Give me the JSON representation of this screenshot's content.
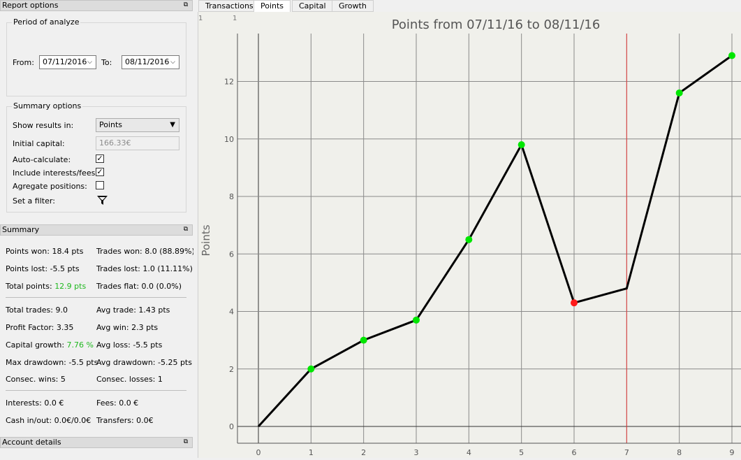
{
  "report_options": {
    "title": "Report options",
    "period_group": "Period of analyze",
    "from_label": "From:",
    "from_value": "07/11/2016",
    "to_label": "To:",
    "to_value": "08/11/2016",
    "summary_group": "Summary options",
    "show_results_label": "Show results in:",
    "show_results_value": "Points",
    "initial_capital_label": "Initial capital:",
    "initial_capital_value": "166.33€",
    "auto_calc_label": "Auto-calculate:",
    "auto_calc_checked": "✓",
    "include_fees_label": "Include interests/fees:",
    "include_fees_checked": "✓",
    "aggregate_label": "Agregate positions:",
    "filter_label": "Set a filter:"
  },
  "summary": {
    "title": "Summary",
    "points_won": "Points won: 18.4 pts",
    "trades_won": "Trades won: 8.0 (88.89%)",
    "points_lost": "Points lost: -5.5 pts",
    "trades_lost": "Trades lost: 1.0 (11.11%)",
    "total_points_label": "Total points:",
    "total_points_value": "12.9 pts",
    "trades_flat": "Trades flat: 0.0 (0.0%)",
    "total_trades": "Total trades: 9.0",
    "avg_trade": "Avg trade: 1.43 pts",
    "profit_factor": "Profit Factor: 3.35",
    "avg_win": "Avg win: 2.3 pts",
    "capital_growth_label": "Capital growth:",
    "capital_growth_value": "7.76 %",
    "avg_loss": "Avg loss: -5.5 pts",
    "max_drawdown": "Max drawdown: -5.5 pts",
    "avg_drawdown": "Avg drawdown: -5.25 pts",
    "consec_wins": "Consec. wins: 5",
    "consec_losses": "Consec. losses: 1",
    "interests": "Interests: 0.0 €",
    "fees": "Fees: 0.0 €",
    "cash_in_out": "Cash in/out: 0.0€/0.0€",
    "transfers": "Transfers: 0.0€"
  },
  "account_details": {
    "title": "Account details"
  },
  "tabs": [
    "Transactions",
    "Points",
    "Capital",
    "Growth"
  ],
  "active_tab": "Points",
  "colors": {
    "win": "#00e600",
    "loss": "#ff1a1a",
    "line": "#000000",
    "marker_line": "#e23b3b",
    "positive_text": "#1fb81f"
  },
  "chart_data": {
    "type": "line",
    "title": "Points from 07/11/16 to 08/11/16",
    "ylabel": "Points",
    "xlabel": "",
    "corner_labels": [
      "1",
      "1"
    ],
    "x": [
      0,
      1,
      2,
      3,
      4,
      5,
      6,
      7,
      8,
      9
    ],
    "y": [
      0,
      2.0,
      3.0,
      3.7,
      6.5,
      9.8,
      4.3,
      4.8,
      11.6,
      12.9
    ],
    "point_result": [
      "none",
      "win",
      "win",
      "win",
      "win",
      "win",
      "loss",
      "none",
      "win",
      "win"
    ],
    "xlim": [
      0,
      9
    ],
    "ylim": [
      0,
      13
    ],
    "xticks": [
      0,
      1,
      2,
      3,
      4,
      5,
      6,
      7,
      8,
      9
    ],
    "yticks": [
      0,
      2,
      4,
      6,
      8,
      10,
      12
    ],
    "vertical_marker_x": 7,
    "grid": true
  }
}
